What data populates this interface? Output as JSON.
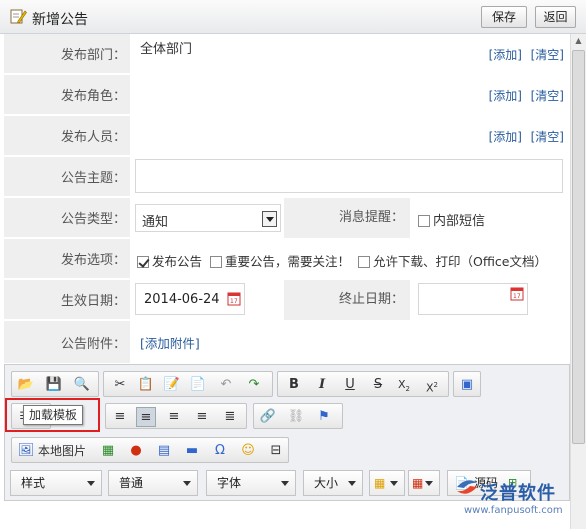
{
  "header": {
    "title": "新增公告",
    "save_label": "保存",
    "back_label": "返回"
  },
  "form": {
    "dept_label": "发布部门：",
    "dept_value": "全体部门",
    "add_label": "[添加]",
    "clear_label": "[清空]",
    "role_label": "发布角色：",
    "person_label": "发布人员：",
    "subject_label": "公告主题：",
    "type_label": "公告类型：",
    "type_value": "通知",
    "remind_label": "消息提醒：",
    "remind_option": "内部短信",
    "options_label": "发布选项：",
    "opt_publish": "发布公告",
    "opt_important": "重要公告，需要关注！",
    "opt_download": "允许下载、打印（Office文档）",
    "effective_label": "生效日期：",
    "effective_value": "2014-06-24",
    "end_label": "终止日期：",
    "attach_label": "公告附件：",
    "attach_link": "[添加附件]"
  },
  "editor": {
    "tooltip": "加载模板",
    "local_image": "本地图片",
    "style_label": "样式",
    "format_label": "普通",
    "font_label": "字体",
    "size_label": "大小",
    "source_label": "源码"
  },
  "watermark": {
    "brand": "泛普软件",
    "url": "www.fanpusoft.com"
  },
  "colors": {
    "link": "#2a5d9e",
    "label_bg": "#efefef",
    "highlight": "#e02020"
  }
}
